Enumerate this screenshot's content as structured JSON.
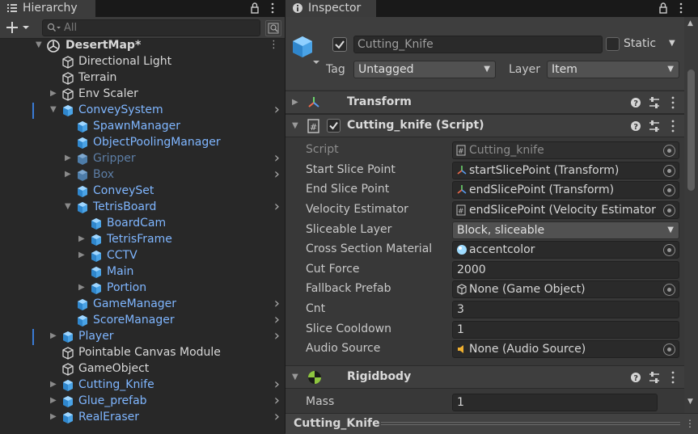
{
  "hierarchy": {
    "tab_label": "Hierarchy",
    "search_placeholder": "All",
    "items": [
      {
        "name": "DesertMap*",
        "color": "white"
      },
      {
        "name": "Directional Light",
        "color": "white"
      },
      {
        "name": "Terrain",
        "color": "white"
      },
      {
        "name": "Env Scaler",
        "color": "white"
      },
      {
        "name": "ConveySystem",
        "color": "blue"
      },
      {
        "name": "SpawnManager",
        "color": "blue"
      },
      {
        "name": "ObjectPoolingManager",
        "color": "blue"
      },
      {
        "name": "Gripper",
        "color": "blue-dim"
      },
      {
        "name": "Box",
        "color": "blue-dim"
      },
      {
        "name": "ConveySet",
        "color": "blue"
      },
      {
        "name": "TetrisBoard",
        "color": "blue"
      },
      {
        "name": "BoardCam",
        "color": "blue"
      },
      {
        "name": "TetrisFrame",
        "color": "blue"
      },
      {
        "name": "CCTV",
        "color": "blue"
      },
      {
        "name": "Main",
        "color": "blue"
      },
      {
        "name": "Portion",
        "color": "blue"
      },
      {
        "name": "GameManager",
        "color": "blue"
      },
      {
        "name": "ScoreManager",
        "color": "blue"
      },
      {
        "name": "Player",
        "color": "blue"
      },
      {
        "name": "Pointable Canvas Module",
        "color": "white"
      },
      {
        "name": "GameObject",
        "color": "white"
      },
      {
        "name": "Cutting_Knife",
        "color": "blue"
      },
      {
        "name": "Glue_prefab",
        "color": "blue"
      },
      {
        "name": "RealEraser",
        "color": "blue"
      }
    ]
  },
  "inspector": {
    "tab_label": "Inspector",
    "object_name": "Cutting_Knife",
    "static_label": "Static",
    "tag_label": "Tag",
    "tag_value": "Untagged",
    "layer_label": "Layer",
    "layer_value": "Item",
    "transform_title": "Transform",
    "script_title": "Cutting_knife (Script)",
    "rigidbody_title": "Rigidbody",
    "fields": [
      {
        "label": "Script",
        "value": "Cutting_knife",
        "icon": "script-icon"
      },
      {
        "label": "Start Slice Point",
        "value": "startSlicePoint (Transform)",
        "icon": "transform-icon"
      },
      {
        "label": "End Slice Point",
        "value": "endSlicePoint (Transform)",
        "icon": "transform-icon"
      },
      {
        "label": "Velocity Estimator",
        "value": "endSlicePoint (Velocity Estimator",
        "icon": "script-icon"
      },
      {
        "label": "Sliceable Layer",
        "value": "Block, sliceable",
        "icon": "dropdown"
      },
      {
        "label": "Cross Section Material",
        "value": "accentcolor",
        "icon": "material-icon"
      },
      {
        "label": "Cut Force",
        "value": "2000",
        "icon": "none"
      },
      {
        "label": "Fallback Prefab",
        "value": "None (Game Object)",
        "icon": "cube-icon"
      },
      {
        "label": "Cnt",
        "value": "3",
        "icon": "none"
      },
      {
        "label": "Slice Cooldown",
        "value": "1",
        "icon": "none"
      },
      {
        "label": "Audio Source",
        "value": "None (Audio Source)",
        "icon": "audio-icon"
      }
    ],
    "rigidbody_fields": [
      {
        "label": "Mass",
        "value": "1"
      }
    ],
    "footer_label": "Cutting_Knife"
  },
  "colors": {
    "accent_blue": "#7fb6ff",
    "panel_bg": "#383838",
    "hierarchy_bg": "#282828"
  }
}
